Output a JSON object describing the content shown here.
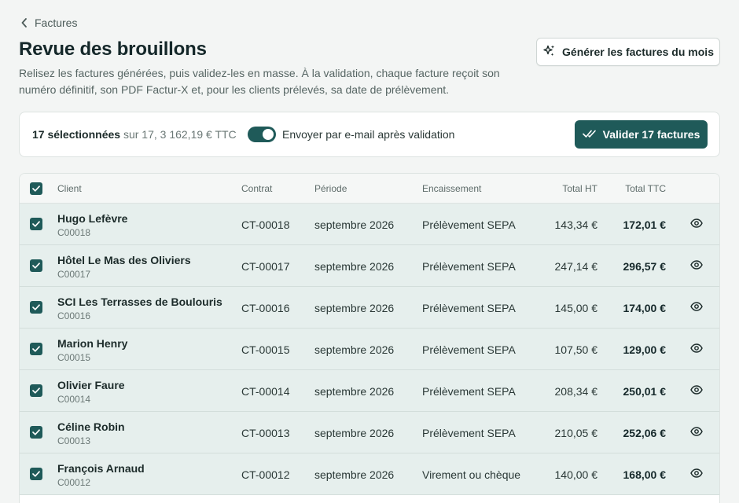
{
  "breadcrumb": {
    "back_label": "Factures"
  },
  "header": {
    "title": "Revue des brouillons",
    "subtitle": "Relisez les factures générées, puis validez-les en masse. À la validation, chaque facture reçoit son numéro définitif, son PDF Factur-X et, pour les clients prélevés, sa date de prélèvement.",
    "generate_label": "Générer les factures du mois"
  },
  "action_bar": {
    "selected_count_label": "17 sélectionnées",
    "selected_rest_label": "sur 17, 3 162,19 € TTC",
    "email_toggle_label": "Envoyer par e-mail après validation",
    "email_toggle_on": true,
    "validate_label": "Valider 17 factures"
  },
  "table": {
    "columns": {
      "client": "Client",
      "contract": "Contrat",
      "period": "Période",
      "payment": "Encaissement",
      "total_ht": "Total HT",
      "total_ttc": "Total TTC"
    },
    "rows": [
      {
        "name": "Hugo Lefèvre",
        "code": "C00018",
        "contract": "CT-00018",
        "period": "septembre 2026",
        "payment": "Prélèvement SEPA",
        "ht": "143,34 €",
        "ttc": "172,01 €",
        "checked": true
      },
      {
        "name": "Hôtel Le Mas des Oliviers",
        "code": "C00017",
        "contract": "CT-00017",
        "period": "septembre 2026",
        "payment": "Prélèvement SEPA",
        "ht": "247,14 €",
        "ttc": "296,57 €",
        "checked": true
      },
      {
        "name": "SCI Les Terrasses de Boulouris",
        "code": "C00016",
        "contract": "CT-00016",
        "period": "septembre 2026",
        "payment": "Prélèvement SEPA",
        "ht": "145,00 €",
        "ttc": "174,00 €",
        "checked": true
      },
      {
        "name": "Marion Henry",
        "code": "C00015",
        "contract": "CT-00015",
        "period": "septembre 2026",
        "payment": "Prélèvement SEPA",
        "ht": "107,50 €",
        "ttc": "129,00 €",
        "checked": true
      },
      {
        "name": "Olivier Faure",
        "code": "C00014",
        "contract": "CT-00014",
        "period": "septembre 2026",
        "payment": "Prélèvement SEPA",
        "ht": "208,34 €",
        "ttc": "250,01 €",
        "checked": true
      },
      {
        "name": "Céline Robin",
        "code": "C00013",
        "contract": "CT-00013",
        "period": "septembre 2026",
        "payment": "Prélèvement SEPA",
        "ht": "210,05 €",
        "ttc": "252,06 €",
        "checked": true
      },
      {
        "name": "François Arnaud",
        "code": "C00012",
        "contract": "CT-00012",
        "period": "septembre 2026",
        "payment": "Virement ou chèque",
        "ht": "140,00 €",
        "ttc": "168,00 €",
        "checked": true
      }
    ]
  },
  "colors": {
    "accent": "#1f5a59",
    "row_selected_bg": "#e6efed",
    "page_bg": "#f3f5f4"
  },
  "icons": {
    "back": "chevron-left-icon",
    "generate": "sparkles-icon",
    "validate": "double-check-icon",
    "row_action": "eye-icon",
    "checkbox": "check-icon"
  }
}
